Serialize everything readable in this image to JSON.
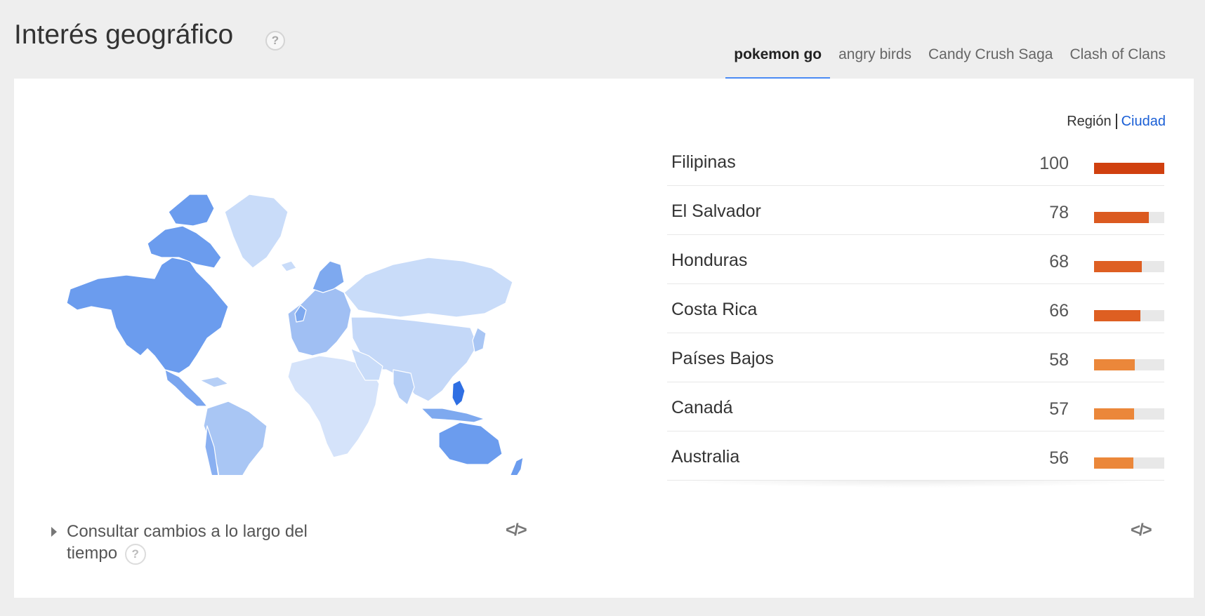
{
  "header": {
    "title": "Interés geográfico",
    "help": "?"
  },
  "tabs": [
    {
      "label": "pokemon go",
      "active": true
    },
    {
      "label": "angry birds",
      "active": false
    },
    {
      "label": "Candy Crush Saga",
      "active": false
    },
    {
      "label": "Clash of Clans",
      "active": false
    }
  ],
  "map": {
    "expander_label": "Consultar cambios a lo largo del tiempo",
    "help": "?",
    "embed_label": "</>"
  },
  "region_switch": {
    "region_label": "Región",
    "city_label": "Ciudad"
  },
  "ranking": {
    "rows": [
      {
        "name": "Filipinas",
        "value": 100,
        "color": "#d0400f"
      },
      {
        "name": "El Salvador",
        "value": 78,
        "color": "#db5a20"
      },
      {
        "name": "Honduras",
        "value": 68,
        "color": "#de5f22"
      },
      {
        "name": "Costa Rica",
        "value": 66,
        "color": "#de5f22"
      },
      {
        "name": "Países Bajos",
        "value": 58,
        "color": "#eb873a"
      },
      {
        "name": "Canadá",
        "value": 57,
        "color": "#eb873a"
      },
      {
        "name": "Australia",
        "value": 56,
        "color": "#eb873a"
      }
    ],
    "embed_label": "</>"
  },
  "colors": {
    "accent": "#4a8af4",
    "link": "#1a5fd6",
    "map_high": "#5a8fe8",
    "map_low": "#c9dcf9"
  }
}
